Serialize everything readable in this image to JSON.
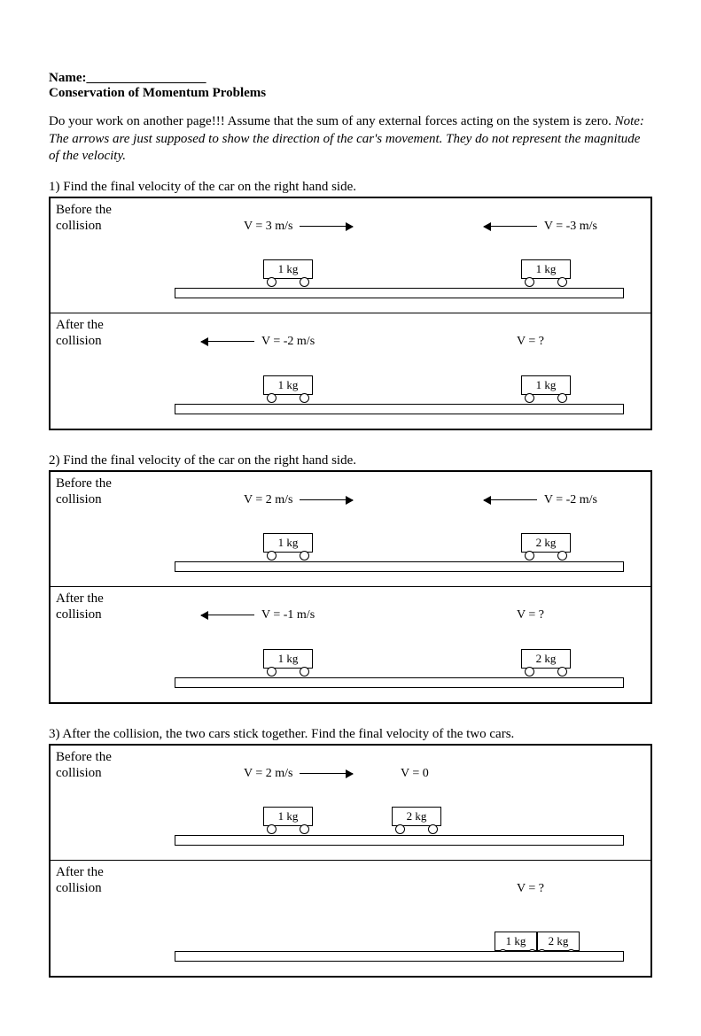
{
  "header": {
    "name_label": "Name:__________________",
    "title": "Conservation of Momentum Problems"
  },
  "instructions": {
    "text1": "Do your work on another page!!!  Assume that the sum of any external forces acting on the system is zero.  ",
    "note": "Note:  The arrows are just supposed to show the direction of the car's movement.  They do not represent the magnitude of the velocity."
  },
  "labels": {
    "before": "Before the\ncollision",
    "after": "After the\ncollision"
  },
  "problems": [
    {
      "prompt": "1)  Find the final velocity of the car on the right hand side.",
      "before": {
        "left": {
          "mass": "1 kg",
          "vel": "V = 3 m/s",
          "dir": "right"
        },
        "right": {
          "mass": "1 kg",
          "vel": "V = -3 m/s",
          "dir": "left"
        }
      },
      "after": {
        "left": {
          "mass": "1 kg",
          "vel": "V = -2 m/s",
          "dir": "left"
        },
        "right": {
          "mass": "1 kg",
          "vel": "V =  ?",
          "dir": "none"
        }
      }
    },
    {
      "prompt": "2)  Find the final velocity of the car on the right hand side.",
      "before": {
        "left": {
          "mass": "1 kg",
          "vel": "V = 2 m/s",
          "dir": "right"
        },
        "right": {
          "mass": "2 kg",
          "vel": "V = -2 m/s",
          "dir": "left"
        }
      },
      "after": {
        "left": {
          "mass": "1 kg",
          "vel": "V = -1 m/s",
          "dir": "left"
        },
        "right": {
          "mass": "2 kg",
          "vel": "V =  ?",
          "dir": "none"
        }
      }
    },
    {
      "prompt": "3)  After the collision, the two cars stick together.  Find the final velocity of the two cars.",
      "before": {
        "left": {
          "mass": "1 kg",
          "vel": "V = 2 m/s",
          "dir": "right",
          "pos": "left"
        },
        "right": {
          "mass": "2 kg",
          "vel": "V = 0",
          "dir": "none",
          "pos": "mid"
        }
      },
      "after": {
        "combined": {
          "mass1": "1 kg",
          "mass2": "2 kg",
          "vel": "V =  ?",
          "dir": "none"
        }
      }
    }
  ]
}
